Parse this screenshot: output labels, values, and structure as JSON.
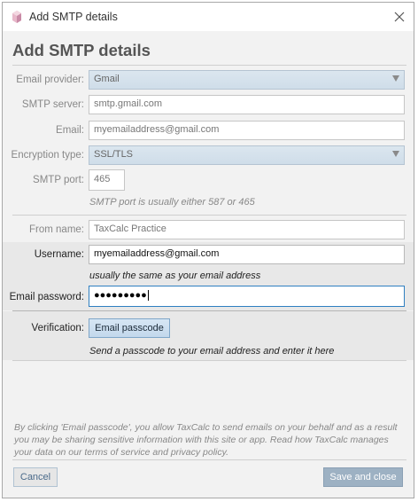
{
  "window": {
    "title": "Add SMTP details"
  },
  "page": {
    "heading": "Add SMTP details"
  },
  "form": {
    "email_provider": {
      "label": "Email provider:",
      "value": "Gmail"
    },
    "smtp_server": {
      "label": "SMTP server:",
      "value": "smtp.gmail.com"
    },
    "email": {
      "label": "Email:",
      "value": "myemailaddress@gmail.com"
    },
    "encryption_type": {
      "label": "Encryption type:",
      "value": "SSL/TLS"
    },
    "smtp_port": {
      "label": "SMTP port:",
      "value": "465",
      "hint": "SMTP port is usually either 587 or 465"
    },
    "from_name": {
      "label": "From name:",
      "value": "TaxCalc Practice"
    },
    "username": {
      "label": "Username:",
      "value": "myemailaddress@gmail.com",
      "hint": "usually the same as your email address"
    },
    "email_password": {
      "label": "Email password:",
      "value": "●●●●●●●●●"
    },
    "verification": {
      "label": "Verification:",
      "button_label": "Email passcode",
      "hint": "Send a passcode to your email address and enter it here"
    }
  },
  "footer": {
    "disclaimer": "By clicking 'Email passcode', you allow TaxCalc to send emails on your behalf and as a result you may be sharing sensitive information with this site or app. Read how TaxCalc manages your data on our terms of service and privacy policy.",
    "cancel_label": "Cancel",
    "save_label": "Save and close"
  },
  "icons": {
    "app": "taxcalc-app-icon",
    "close": "close-icon",
    "dropdown": "chevron-down-icon"
  },
  "colors": {
    "accent": "#2f7fc1",
    "primary_button": "#9db1c3"
  }
}
